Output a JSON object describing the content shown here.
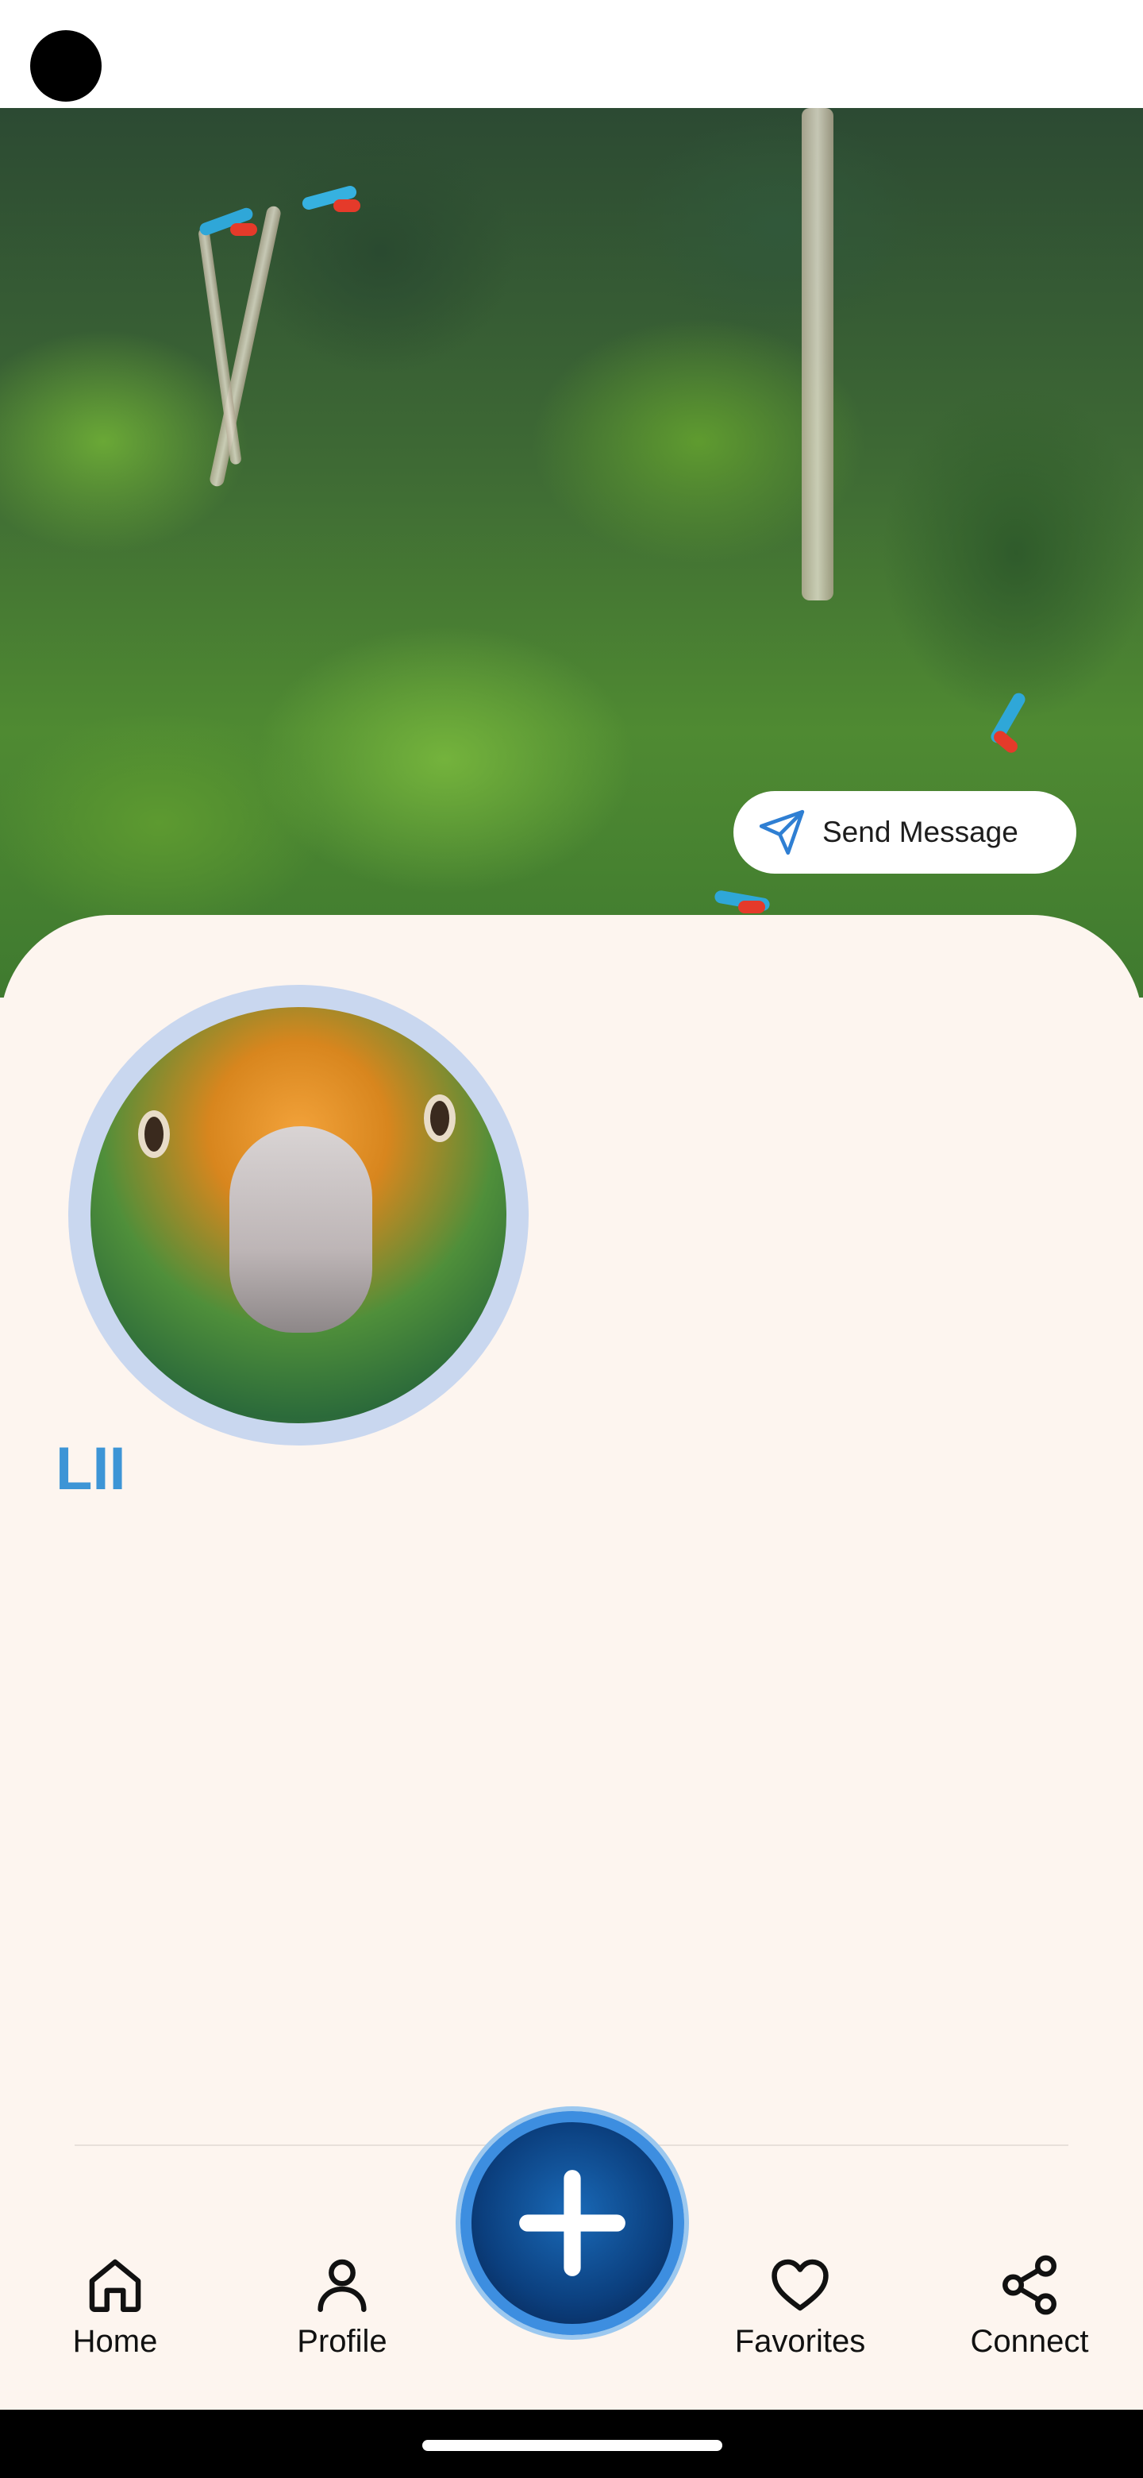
{
  "profile": {
    "name": "LII",
    "send_message_label": "Send Message"
  },
  "nav": {
    "items": [
      {
        "label": "Home",
        "icon": "home-icon"
      },
      {
        "label": "Profile",
        "icon": "person-icon"
      },
      {
        "label": "Favorites",
        "icon": "heart-icon"
      },
      {
        "label": "Connect",
        "icon": "share-icon"
      }
    ],
    "fab_icon": "plus-icon"
  },
  "colors": {
    "accent_name": "#3d95d6",
    "sheet_bg": "#fdf5ef",
    "send_icon": "#2f7fd3",
    "fab_border": "#3d8ee0"
  }
}
